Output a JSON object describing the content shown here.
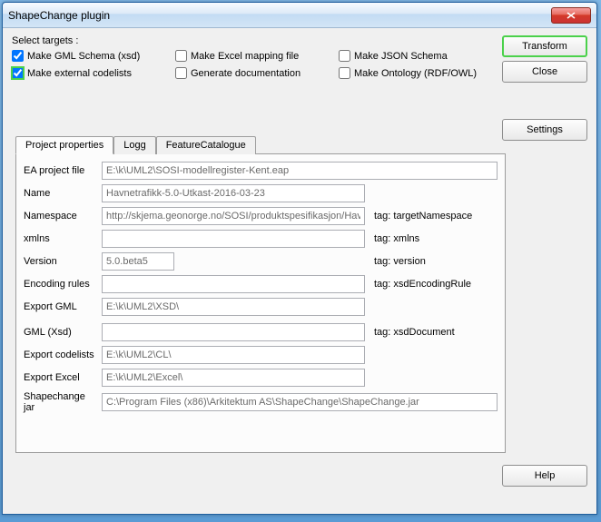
{
  "window": {
    "title": "ShapeChange plugin"
  },
  "targets": {
    "label": "Select targets :",
    "gml_schema": "Make GML Schema (xsd)",
    "excel_map": "Make Excel mapping file",
    "json_schema": "Make JSON Schema",
    "ext_codelists": "Make external codelists",
    "gen_doc": "Generate documentation",
    "ontology": "Make Ontology (RDF/OWL)"
  },
  "buttons": {
    "transform": "Transform",
    "close": "Close",
    "settings": "Settings",
    "help": "Help"
  },
  "tabs": {
    "project": "Project properties",
    "logg": "Logg",
    "featurecat": "FeatureCatalogue"
  },
  "form": {
    "ea_project_label": "EA project file",
    "ea_project_value": "E:\\k\\UML2\\SOSI-modellregister-Kent.eap",
    "name_label": "Name",
    "name_value": "Havnetrafikk-5.0-Utkast-2016-03-23",
    "namespace_label": "Namespace",
    "namespace_value": "http://skjema.geonorge.no/SOSI/produktspesifikasjon/Havn",
    "namespace_tag": "tag: targetNamespace",
    "xmlns_label": "xmlns",
    "xmlns_value": "",
    "xmlns_tag": "tag: xmlns",
    "version_label": "Version",
    "version_value": "5.0.beta5",
    "version_tag": "tag: version",
    "encoding_label": "Encoding rules",
    "encoding_value": "",
    "encoding_tag": "tag: xsdEncodingRule",
    "export_gml_label": "Export GML",
    "export_gml_value": "E:\\k\\UML2\\XSD\\",
    "gml_xsd_label": "GML (Xsd)",
    "gml_xsd_value": "",
    "gml_xsd_tag": "tag: xsdDocument",
    "export_cl_label": "Export codelists",
    "export_cl_value": "E:\\k\\UML2\\CL\\",
    "export_excel_label": "Export Excel",
    "export_excel_value": "E:\\k\\UML2\\Excel\\",
    "sc_jar_label": "Shapechange jar",
    "sc_jar_value": "C:\\Program Files (x86)\\Arkitektum AS\\ShapeChange\\ShapeChange.jar"
  }
}
